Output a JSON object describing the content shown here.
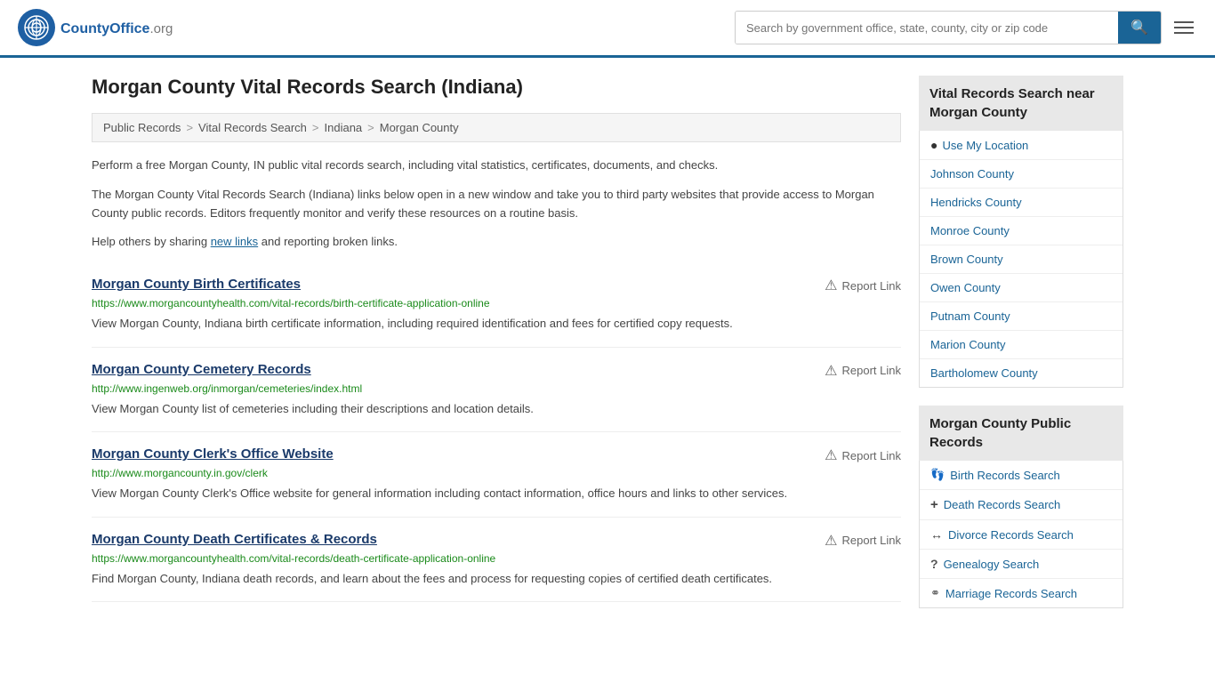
{
  "header": {
    "logo_text": "CountyOffice",
    "logo_suffix": ".org",
    "search_placeholder": "Search by government office, state, county, city or zip code"
  },
  "page": {
    "title": "Morgan County Vital Records Search (Indiana)",
    "breadcrumb": [
      {
        "label": "Public Records",
        "href": "#"
      },
      {
        "label": "Vital Records Search",
        "href": "#"
      },
      {
        "label": "Indiana",
        "href": "#"
      },
      {
        "label": "Morgan County",
        "href": "#"
      }
    ],
    "description1": "Perform a free Morgan County, IN public vital records search, including vital statistics, certificates, documents, and checks.",
    "description2": "The Morgan County Vital Records Search (Indiana) links below open in a new window and take you to third party websites that provide access to Morgan County public records. Editors frequently monitor and verify these resources on a routine basis.",
    "description3_prefix": "Help others by sharing ",
    "new_links_text": "new links",
    "description3_suffix": " and reporting broken links."
  },
  "results": [
    {
      "title": "Morgan County Birth Certificates",
      "url": "https://www.morgancountyhealth.com/vital-records/birth-certificate-application-online",
      "desc": "View Morgan County, Indiana birth certificate information, including required identification and fees for certified copy requests.",
      "report": "Report Link"
    },
    {
      "title": "Morgan County Cemetery Records",
      "url": "http://www.ingenweb.org/inmorgan/cemeteries/index.html",
      "desc": "View Morgan County list of cemeteries including their descriptions and location details.",
      "report": "Report Link"
    },
    {
      "title": "Morgan County Clerk's Office Website",
      "url": "http://www.morgancounty.in.gov/clerk",
      "desc": "View Morgan County Clerk's Office website for general information including contact information, office hours and links to other services.",
      "report": "Report Link"
    },
    {
      "title": "Morgan County Death Certificates & Records",
      "url": "https://www.morgancountyhealth.com/vital-records/death-certificate-application-online",
      "desc": "Find Morgan County, Indiana death records, and learn about the fees and process for requesting copies of certified death certificates.",
      "report": "Report Link"
    }
  ],
  "sidebar": {
    "nearby_header": "Vital Records Search near Morgan County",
    "use_my_location": "Use My Location",
    "nearby_counties": [
      "Johnson County",
      "Hendricks County",
      "Monroe County",
      "Brown County",
      "Owen County",
      "Putnam County",
      "Marion County",
      "Bartholomew County"
    ],
    "public_records_header": "Morgan County Public Records",
    "public_records_links": [
      {
        "icon": "🦶",
        "label": "Birth Records Search"
      },
      {
        "icon": "+",
        "label": "Death Records Search"
      },
      {
        "icon": "↔",
        "label": "Divorce Records Search"
      },
      {
        "icon": "?",
        "label": "Genealogy Search"
      },
      {
        "icon": "⚭",
        "label": "Marriage Records Search"
      }
    ]
  }
}
